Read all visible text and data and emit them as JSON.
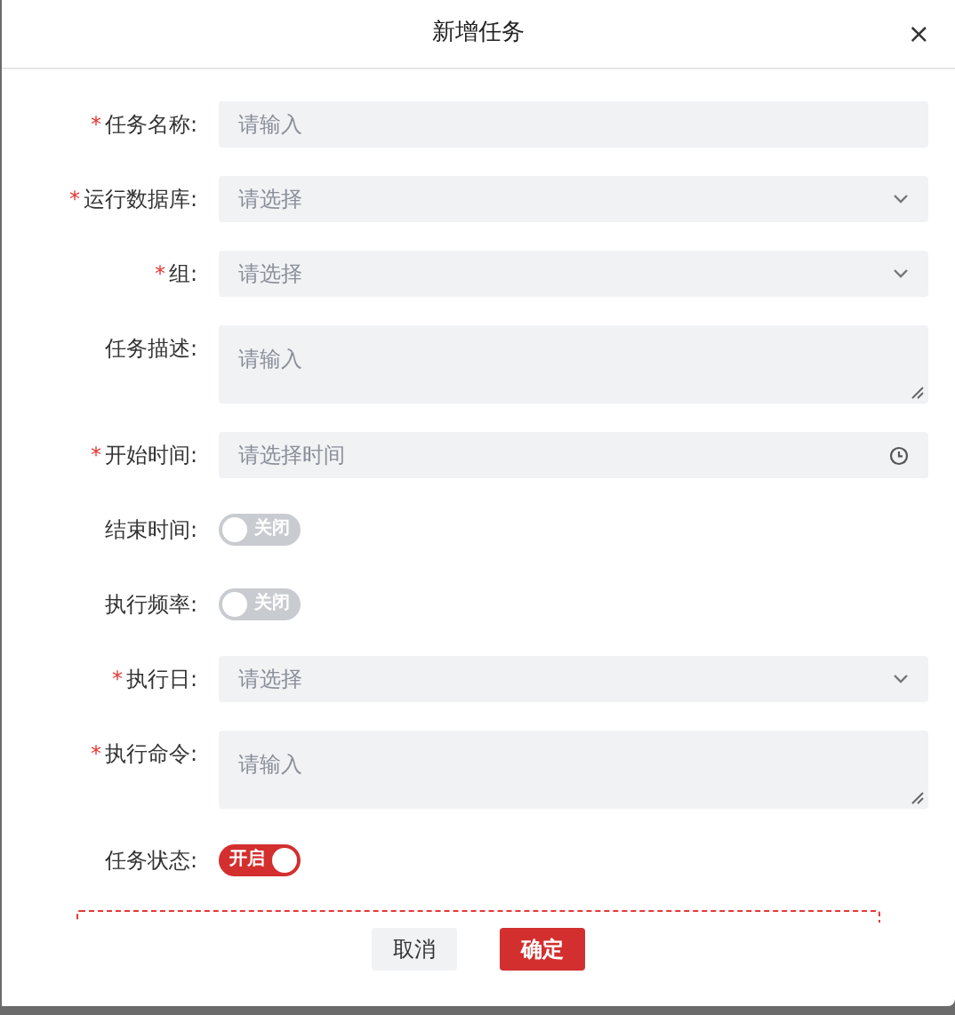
{
  "dialog": {
    "title": "新增任务",
    "close": "×"
  },
  "fields": [
    {
      "kind": "input",
      "label": "任务名称:",
      "required_mark": "*",
      "placeholder": "请输入"
    },
    {
      "kind": "select",
      "label": "运行数据库:",
      "required_mark": "*",
      "placeholder": "请选择"
    },
    {
      "kind": "select",
      "label": "组:",
      "required_mark": "*",
      "placeholder": "请选择"
    },
    {
      "kind": "textarea",
      "label": "任务描述:",
      "placeholder": "请输入"
    },
    {
      "kind": "time",
      "label": "开始时间:",
      "required_mark": "*",
      "placeholder": "请选择时间"
    },
    {
      "kind": "switch",
      "label": "结束时间:",
      "on": false,
      "text": "关闭"
    },
    {
      "kind": "switch",
      "label": "执行频率:",
      "on": false,
      "text": "关闭"
    },
    {
      "kind": "select",
      "label": "执行日:",
      "required_mark": "*",
      "placeholder": "请选择"
    },
    {
      "kind": "textarea",
      "label": "执行命令:",
      "required_mark": "*",
      "placeholder": "请输入"
    },
    {
      "kind": "switch",
      "label": "任务状态:",
      "on": true,
      "text": "开启"
    }
  ],
  "buttons": [
    {
      "label": "取消",
      "primary": false
    },
    {
      "label": "确定",
      "primary": true
    }
  ]
}
